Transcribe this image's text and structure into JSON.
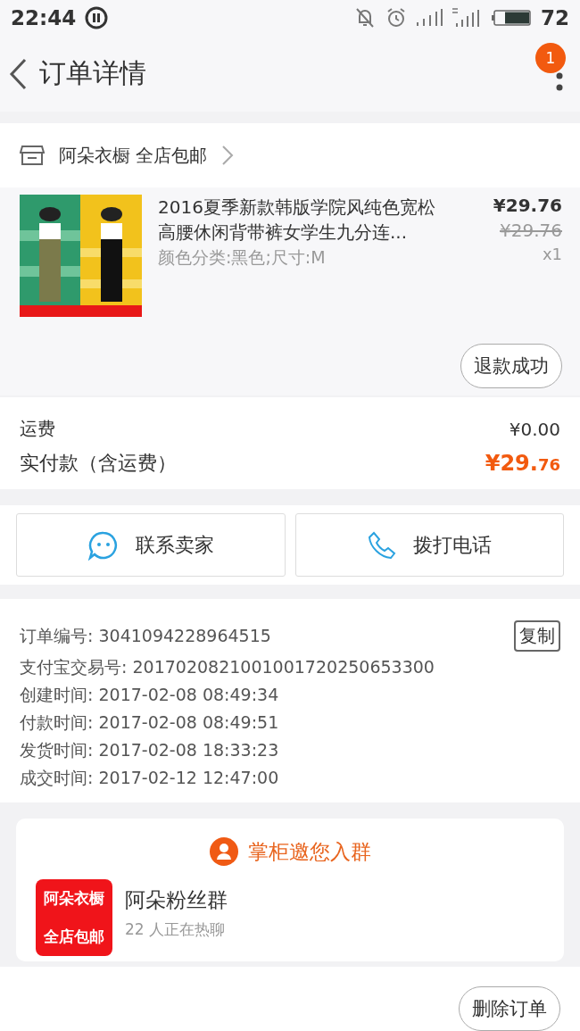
{
  "status_bar": {
    "time": "22:44",
    "battery": "72"
  },
  "header": {
    "title": "订单详情",
    "badge": "1"
  },
  "shop": {
    "name": "阿朵衣橱 全店包邮"
  },
  "item": {
    "title": "2016夏季新款韩版学院风纯色宽松高腰休闲背带裤女学生九分连...",
    "sku": "颜色分类:黑色;尺寸:M",
    "price": "¥29.76",
    "original_price": "¥29.76",
    "quantity": "x1",
    "status_button": "退款成功"
  },
  "fees": [
    {
      "label": "运费",
      "value": "¥0.00",
      "kind": "plain"
    },
    {
      "label": "实付款（含运费）",
      "value": "¥29.",
      "value_small": "76",
      "kind": "total"
    }
  ],
  "actions": [
    {
      "label": "联系卖家",
      "kind": "chat"
    },
    {
      "label": "拨打电话",
      "kind": "phone"
    }
  ],
  "order_info": [
    {
      "label": "订单编号:",
      "value": "3041094228964515",
      "copy": "复制"
    },
    {
      "label": "支付宝交易号:",
      "value": "2017020821001001720250653300"
    },
    {
      "label": "创建时间:",
      "value": "2017-02-08 08:49:34"
    },
    {
      "label": "付款时间:",
      "value": "2017-02-08 08:49:51"
    },
    {
      "label": "发货时间:",
      "value": "2017-02-08 18:33:23"
    },
    {
      "label": "成交时间:",
      "value": "2017-02-12 12:47:00"
    }
  ],
  "group_card": {
    "title": "掌柜邀您入群",
    "logo_lines": [
      "阿朵衣橱",
      "全店包邮"
    ],
    "name": "阿朵粉丝群",
    "subtitle": "22 人正在热聊"
  },
  "bottom_bar": {
    "button": "删除订单"
  }
}
